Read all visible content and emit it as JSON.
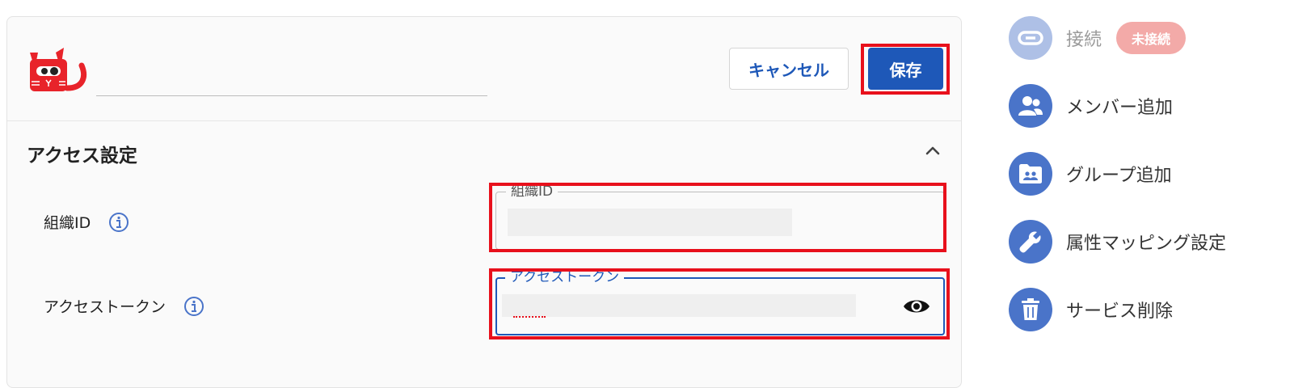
{
  "header": {
    "cancel_label": "キャンセル",
    "save_label": "保存"
  },
  "section": {
    "title": "アクセス設定"
  },
  "fields": {
    "org_id": {
      "label": "組織ID",
      "legend": "組織ID"
    },
    "access_token": {
      "label": "アクセストークン",
      "legend": "アクセストークン"
    }
  },
  "sidebar": {
    "items": [
      {
        "label": "接続",
        "icon": "link-icon",
        "disabled": true,
        "badge": "未接続"
      },
      {
        "label": "メンバー追加",
        "icon": "users-icon"
      },
      {
        "label": "グループ追加",
        "icon": "group-folder-icon"
      },
      {
        "label": "属性マッピング設定",
        "icon": "wrench-icon"
      },
      {
        "label": "サービス削除",
        "icon": "trash-icon"
      }
    ]
  },
  "colors": {
    "primary": "#1e58b8",
    "highlight": "#e8101c",
    "sidebar_icon": "#4a74c9",
    "badge": "#f3aaa8",
    "logo_red": "#e8232a"
  }
}
